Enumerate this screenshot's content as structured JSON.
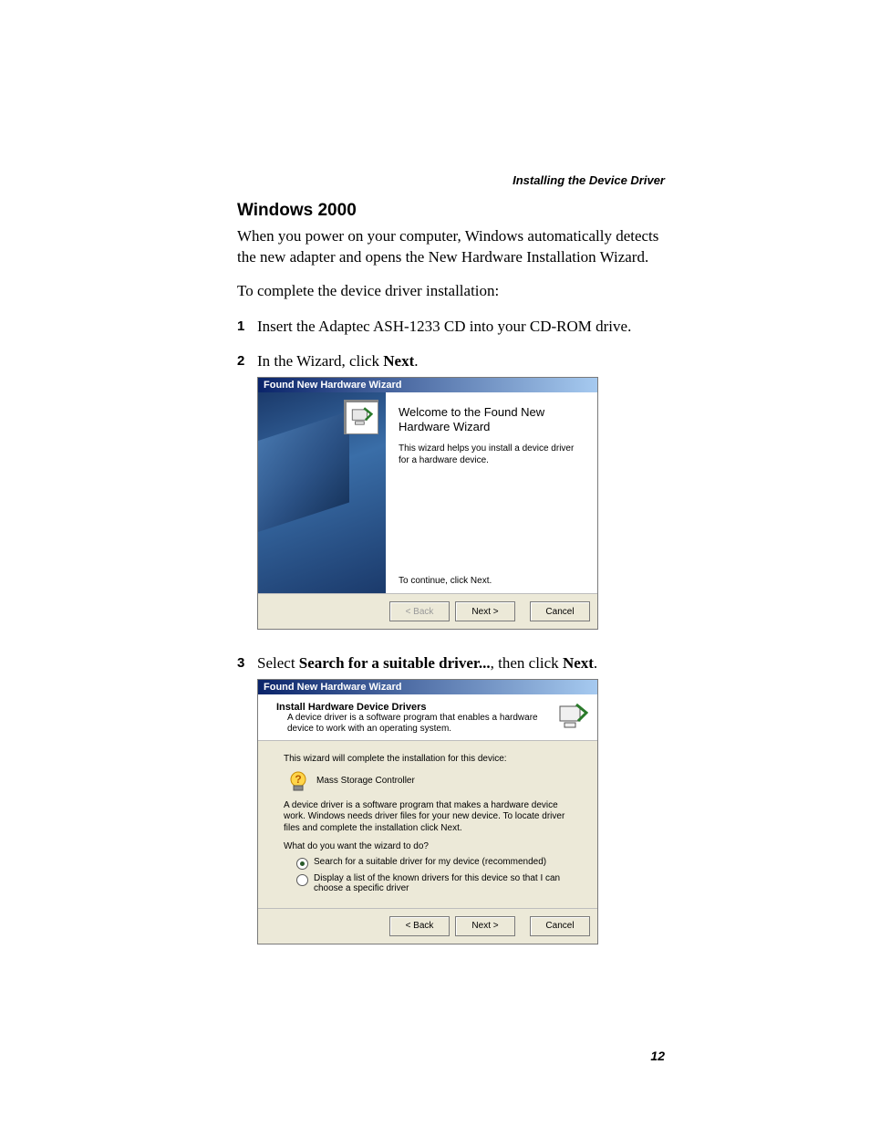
{
  "running_head": "Installing the Device Driver",
  "section_title": "Windows 2000",
  "intro_text": "When you power on your computer, Windows automatically detects the new adapter and opens the New Hardware Installation Wizard.",
  "intro_followup": "To complete the device driver installation:",
  "steps": {
    "s1": {
      "num": "1",
      "text_a": "Insert the Adaptec ASH-1233 CD into your CD-ROM drive."
    },
    "s2": {
      "num": "2",
      "text_a": "In the Wizard, click ",
      "bold_a": "Next",
      "text_b": "."
    },
    "s3": {
      "num": "3",
      "text_a": "Select ",
      "bold_a": "Search for a suitable driver...",
      "text_b": ", then click ",
      "bold_b": "Next",
      "text_c": "."
    }
  },
  "wizard1": {
    "title": "Found New Hardware Wizard",
    "heading": "Welcome to the Found New Hardware Wizard",
    "body": "This wizard helps you install a device driver for a hardware device.",
    "footer": "To continue, click Next.",
    "buttons": {
      "back": "< Back",
      "next": "Next >",
      "cancel": "Cancel"
    }
  },
  "wizard2": {
    "title": "Found New Hardware Wizard",
    "header_title": "Install Hardware Device Drivers",
    "header_sub": "A device driver is a software program that enables a hardware device to work with an operating system.",
    "line1": "This wizard will complete the installation for this device:",
    "device_name": "Mass Storage Controller",
    "line2": "A device driver is a software program that makes a hardware device work. Windows needs driver files for your new device. To locate driver files and complete the installation click Next.",
    "question": "What do you want the wizard to do?",
    "option1": "Search for a suitable driver for my device (recommended)",
    "option2": "Display a list of the known drivers for this device so that I can choose a specific driver",
    "buttons": {
      "back": "< Back",
      "next": "Next >",
      "cancel": "Cancel"
    }
  },
  "page_number": "12"
}
